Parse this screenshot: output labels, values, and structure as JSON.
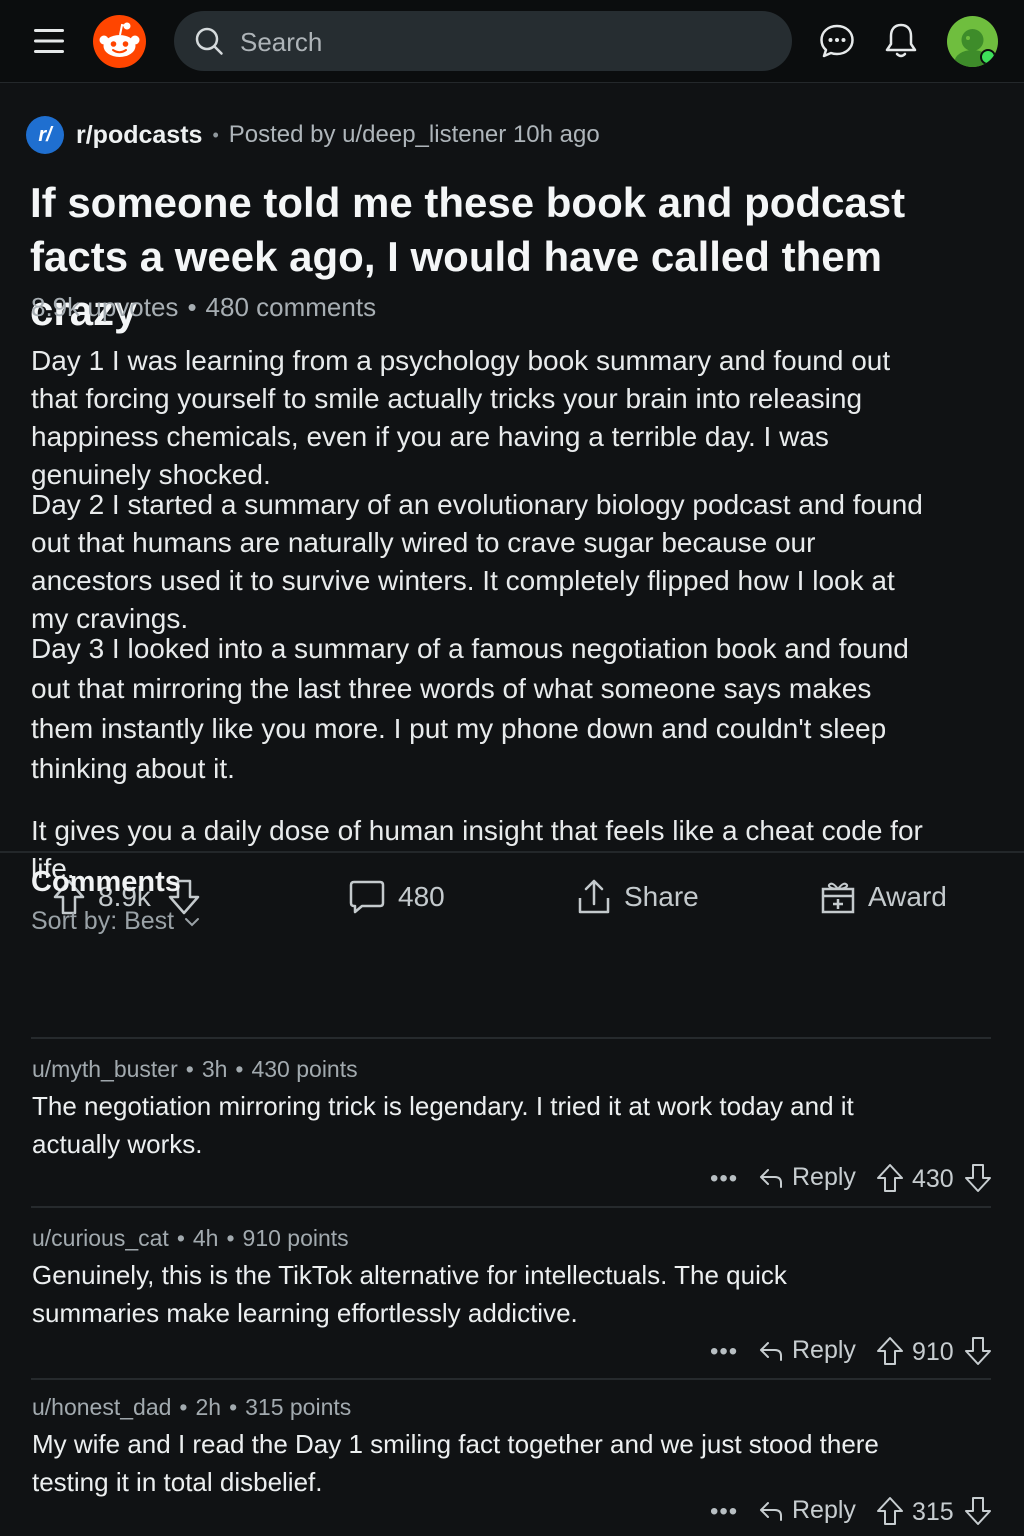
{
  "header": {
    "search_placeholder": "Search",
    "icons": [
      "menu-icon",
      "reddit-logo",
      "search-icon",
      "chat-icon",
      "bell-icon",
      "avatar"
    ]
  },
  "post": {
    "subreddit": "r/podcasts",
    "subreddit_icon_text": "r/",
    "posted_by": "Posted by u/deep_listener 10h ago",
    "title": "If someone told me these book and podcast facts a week ago, I would have called them crazy",
    "upvotes_label": "8.9k upvotes",
    "comments_label": "480 comments",
    "paragraphs": [
      "Day 1 I was learning from a psychology book summary and found out that forcing yourself to smile actually tricks your brain into releasing happiness chemicals, even if you are having a terrible day. I was genuinely shocked.",
      "Day 2 I started a summary of an evolutionary biology podcast and found out that humans are naturally wired to crave sugar because our ancestors used it to survive winters. It completely flipped how I look at my cravings.",
      "Day 3 I looked into a summary of a famous negotiation book and found out that mirroring the last three words of what someone says makes them instantly like you more. I put my phone down and couldn't sleep thinking about it.",
      "It gives you a daily dose of human insight that feels like a cheat code for life."
    ],
    "actions": {
      "score": "8.9k",
      "comments": "480",
      "share": "Share",
      "award": "Award"
    }
  },
  "comments_section": {
    "title": "Comments",
    "sort_label": "Sort by: Best",
    "comments": [
      {
        "user": "u/myth_buster",
        "age": "3h",
        "points": "430 points",
        "text": "The negotiation mirroring trick is legendary. I tried it at work today and it actually works.",
        "more": "•••",
        "reply": "Reply",
        "score": "430"
      },
      {
        "user": "u/curious_cat",
        "age": "4h",
        "points": "910 points",
        "text": "Genuinely, this is the TikTok alternative for intellectuals. The quick summaries make learning effortlessly addictive.",
        "more": "•••",
        "reply": "Reply",
        "score": "910"
      },
      {
        "user": "u/honest_dad",
        "age": "2h",
        "points": "315 points",
        "text": "My wife and I read the Day 1 smiling fact together and we just stood there testing it in total disbelief.",
        "more": "•••",
        "reply": "Reply",
        "score": "315"
      }
    ]
  },
  "colors": {
    "background": "#101214",
    "brand": "#ff4500",
    "subreddit_icon": "#1f6fd0",
    "avatar": "#6fbe3e"
  }
}
